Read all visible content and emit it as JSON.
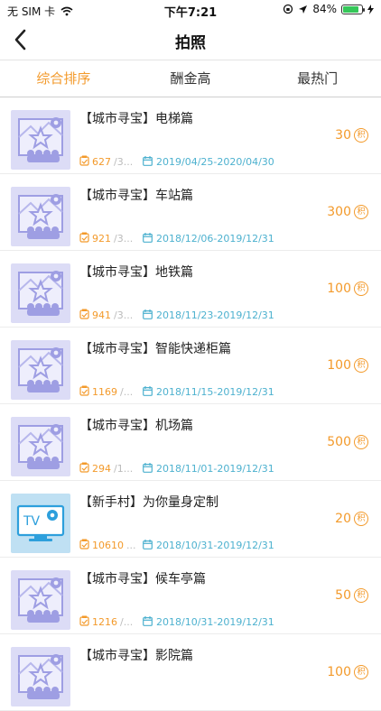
{
  "status": {
    "carrier": "无 SIM 卡",
    "time": "下午7:21",
    "battery_pct": "84%"
  },
  "nav": {
    "back_icon": "chevron-left-icon",
    "title": "拍照"
  },
  "tabs": [
    {
      "label": "综合排序",
      "active": true
    },
    {
      "label": "酬金高",
      "active": false
    },
    {
      "label": "最热门",
      "active": false
    }
  ],
  "coin_label": "积",
  "items": [
    {
      "title": "【城市寻宝】电梯篇",
      "count": "627",
      "count_rest": "/3...",
      "dates": "2019/04/25-2020/04/30",
      "reward": "30",
      "thumb": "treasure"
    },
    {
      "title": "【城市寻宝】车站篇",
      "count": "921",
      "count_rest": "/3...",
      "dates": "2018/12/06-2019/12/31",
      "reward": "300",
      "thumb": "treasure"
    },
    {
      "title": "【城市寻宝】地铁篇",
      "count": "941",
      "count_rest": "/3...",
      "dates": "2018/11/23-2019/12/31",
      "reward": "100",
      "thumb": "treasure"
    },
    {
      "title": "【城市寻宝】智能快递柜篇",
      "count": "1169",
      "count_rest": "/...",
      "dates": "2018/11/15-2019/12/31",
      "reward": "100",
      "thumb": "treasure"
    },
    {
      "title": "【城市寻宝】机场篇",
      "count": "294",
      "count_rest": "/1...",
      "dates": "2018/11/01-2019/12/31",
      "reward": "500",
      "thumb": "treasure"
    },
    {
      "title": "【新手村】为你量身定制",
      "count": "10610",
      "count_rest": "...",
      "dates": "2018/10/31-2019/12/31",
      "reward": "20",
      "thumb": "tv"
    },
    {
      "title": "【城市寻宝】候车亭篇",
      "count": "1216",
      "count_rest": "/...",
      "dates": "2018/10/31-2019/12/31",
      "reward": "50",
      "thumb": "treasure"
    },
    {
      "title": "【城市寻宝】影院篇",
      "count": "",
      "count_rest": "",
      "dates": "",
      "reward": "100",
      "thumb": "treasure"
    }
  ]
}
